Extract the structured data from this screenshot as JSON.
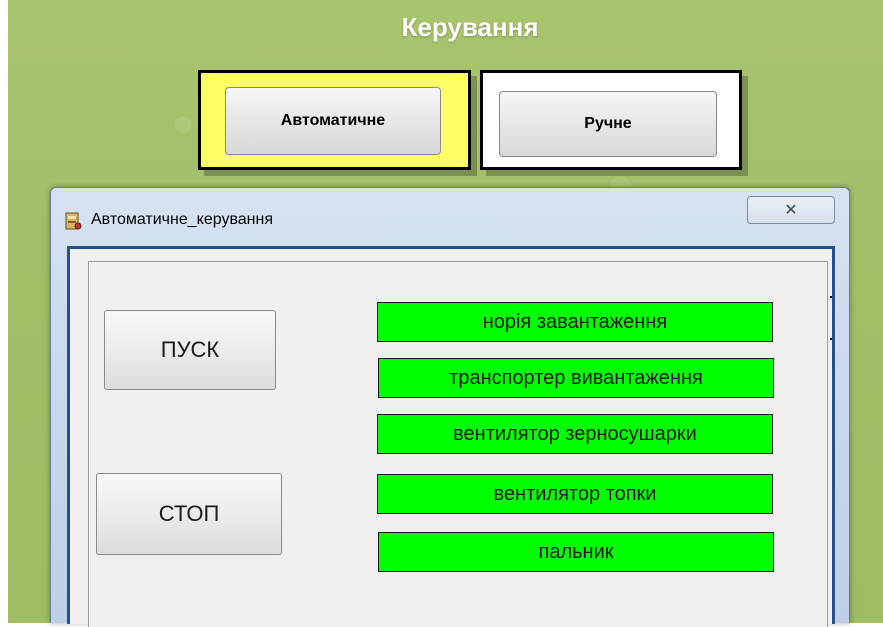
{
  "header": {
    "title": "Керування"
  },
  "mode": {
    "auto_label": "Автоматичне",
    "manual_label": "Ручне",
    "active_color": "#ffff66"
  },
  "window": {
    "title": "Автоматичне_керування",
    "close_label": "✕",
    "icon": "app-icon",
    "controls": {
      "start_label": "ПУСК",
      "stop_label": "СТОП"
    },
    "indicators": [
      {
        "label": "норія завантаження",
        "color": "#00ff00"
      },
      {
        "label": "транспортер вивантаження",
        "color": "#00ff00"
      },
      {
        "label": "вентилятор зерносушарки",
        "color": "#00ff00"
      },
      {
        "label": "вентилятор топки",
        "color": "#00ff00"
      },
      {
        "label": "пальник",
        "color": "#00ff00"
      }
    ]
  }
}
